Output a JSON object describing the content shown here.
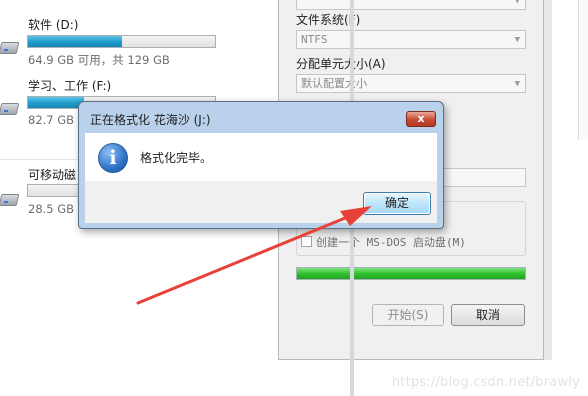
{
  "drives": [
    {
      "name": "软件 (D:)",
      "size": "64.9 GB 可用，共 129 GB",
      "used_fraction": 0.5
    },
    {
      "name": "学习、工作 (F:)",
      "size": "82.7 GB",
      "used_fraction": 0.3
    },
    {
      "name": "可移动磁",
      "size": "28.5 GB",
      "used_fraction": 0.0
    }
  ],
  "format_dialog": {
    "filesystem_label": "文件系统(F)",
    "filesystem_value": "NTFS",
    "allocation_label": "分配单元大小(A)",
    "allocation_value": "默认配置大小",
    "create_boot_disk_label": "创建一个 MS-DOS 启动盘(M)",
    "progress_fraction": 1.0,
    "start_button": "开始(S)",
    "cancel_button": "取消"
  },
  "message_box": {
    "title": "正在格式化 花海沙 (J:)",
    "close_symbol": "x",
    "message": "格式化完毕。",
    "info_icon_glyph": "i",
    "ok_button": "确定"
  },
  "annotation": {
    "arrow_color": "#e8413a"
  },
  "watermark": "https://blog.csdn.net/brawly"
}
